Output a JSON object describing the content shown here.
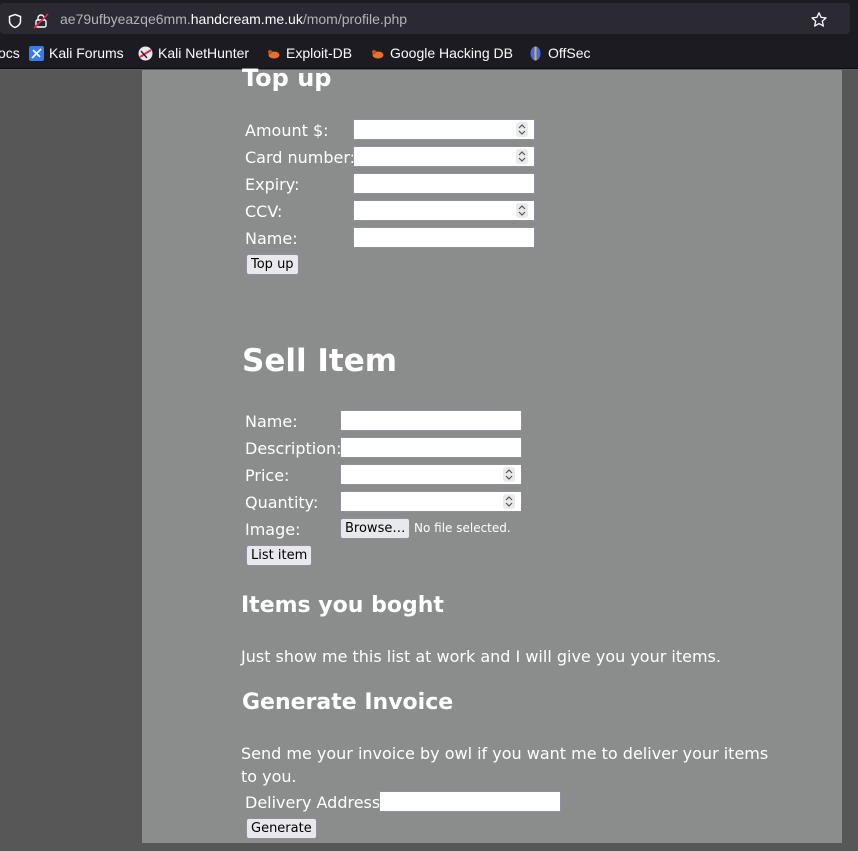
{
  "browser": {
    "url_prefix": "ae79ufbyeazqe6mm.",
    "url_host": "handcream.me.uk",
    "url_path": "/mom/profile.php",
    "bookmarks": [
      {
        "label": "ocs",
        "icon": "docs-icon"
      },
      {
        "label": "Kali Forums",
        "icon": "kali-forums-icon"
      },
      {
        "label": "Kali NetHunter",
        "icon": "kali-nethunter-icon"
      },
      {
        "label": "Exploit-DB",
        "icon": "exploit-db-icon"
      },
      {
        "label": "Google Hacking DB",
        "icon": "ghdb-icon"
      },
      {
        "label": "OffSec",
        "icon": "offsec-icon"
      }
    ]
  },
  "topup": {
    "heading": "Top up",
    "fields": [
      {
        "label": "Amount $:",
        "value": ""
      },
      {
        "label": "Card number:",
        "value": ""
      },
      {
        "label": "Expiry:",
        "value": ""
      },
      {
        "label": "CCV:",
        "value": ""
      },
      {
        "label": "Name:",
        "value": ""
      }
    ],
    "button": "Top up"
  },
  "sell": {
    "heading": "Sell Item",
    "fields": [
      {
        "label": "Name:",
        "value": ""
      },
      {
        "label": "Description:",
        "value": ""
      },
      {
        "label": "Price:",
        "value": ""
      },
      {
        "label": "Quantity:",
        "value": ""
      },
      {
        "label": "Image:",
        "value": ""
      }
    ],
    "browse_button": "Browse…",
    "no_file": "No file selected.",
    "button": "List item"
  },
  "bought": {
    "heading": "Items you boght",
    "text": "Just show me this list at work and I will give you your items."
  },
  "invoice": {
    "heading": "Generate Invoice",
    "text_line1": "Send me your invoice by owl if you want me to deliver your items",
    "text_line2": "to you.",
    "address_label": "Delivery Address:",
    "address_value": "",
    "button": "Generate"
  }
}
